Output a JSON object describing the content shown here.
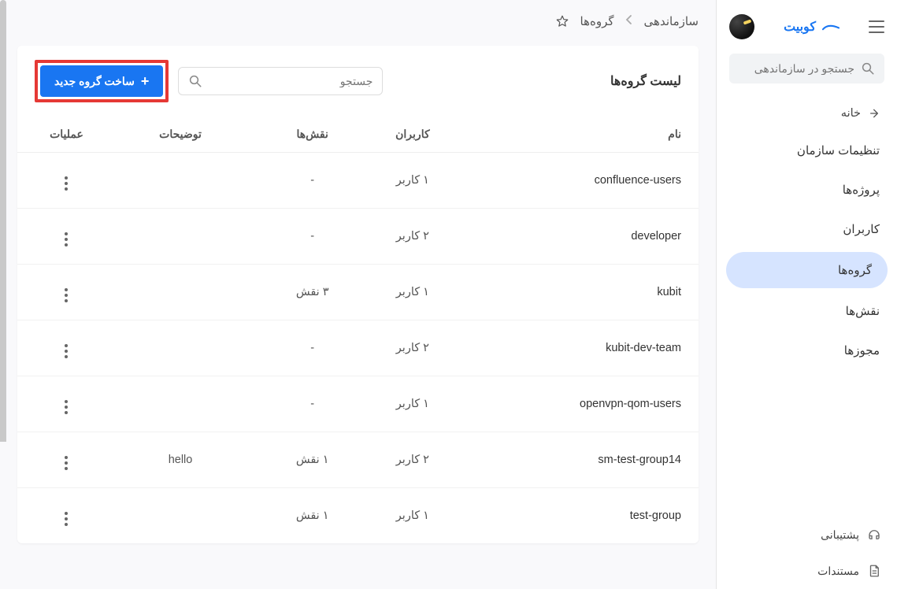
{
  "brand": "کوبیت",
  "sidebar": {
    "search_placeholder": "جستجو در سازماندهی",
    "home": "خانه",
    "items": [
      {
        "label": "تنظیمات سازمان",
        "active": false
      },
      {
        "label": "پروژه‌ها",
        "active": false
      },
      {
        "label": "کاربران",
        "active": false
      },
      {
        "label": "گروه‌ها",
        "active": true
      },
      {
        "label": "نقش‌ها",
        "active": false
      },
      {
        "label": "مجوزها",
        "active": false
      }
    ],
    "support": "پشتیبانی",
    "docs": "مستندات"
  },
  "breadcrumbs": {
    "root": "سازماندهی",
    "current": "گروه‌ها"
  },
  "page": {
    "title": "لیست گروه‌ها",
    "search_placeholder": "جستجو",
    "new_button": "ساخت گروه جدید"
  },
  "table": {
    "headers": {
      "name": "نام",
      "users": "کاربران",
      "roles": "نقش‌ها",
      "desc": "توضیحات",
      "ops": "عملیات"
    },
    "rows": [
      {
        "name": "confluence-users",
        "users": "۱ کاربر",
        "roles": "-",
        "desc": ""
      },
      {
        "name": "developer",
        "users": "۲ کاربر",
        "roles": "-",
        "desc": ""
      },
      {
        "name": "kubit",
        "users": "۱ کاربر",
        "roles": "۳ نقش",
        "desc": ""
      },
      {
        "name": "kubit-dev-team",
        "users": "۲ کاربر",
        "roles": "-",
        "desc": ""
      },
      {
        "name": "openvpn-qom-users",
        "users": "۱ کاربر",
        "roles": "-",
        "desc": ""
      },
      {
        "name": "sm-test-group14",
        "users": "۲ کاربر",
        "roles": "۱ نقش",
        "desc": "hello"
      },
      {
        "name": "test-group",
        "users": "۱ کاربر",
        "roles": "۱ نقش",
        "desc": ""
      }
    ]
  }
}
